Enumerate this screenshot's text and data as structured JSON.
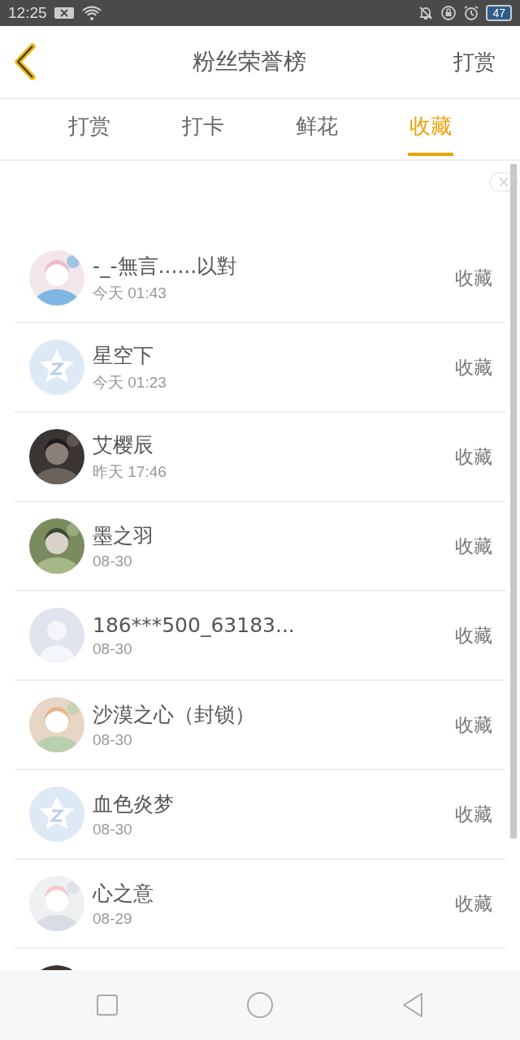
{
  "status_bar": {
    "time": "12:25",
    "battery": "47"
  },
  "header": {
    "title": "粉丝荣誉榜",
    "action": "打赏"
  },
  "tabs": [
    {
      "label": "打赏",
      "selected": false
    },
    {
      "label": "打卡",
      "selected": false
    },
    {
      "label": "鲜花",
      "selected": false
    },
    {
      "label": "收藏",
      "selected": true
    }
  ],
  "fans": [
    {
      "name": "-_-無言......以對",
      "time": "今天 01:43",
      "action": "收藏",
      "kind": "picture"
    },
    {
      "name": "星空下",
      "time": "今天 01:23",
      "action": "收藏",
      "kind": "star"
    },
    {
      "name": "艾樱辰",
      "time": "昨天 17:46",
      "action": "收藏",
      "kind": "picture"
    },
    {
      "name": "墨之羽",
      "time": "08-30",
      "action": "收藏",
      "kind": "picture"
    },
    {
      "name": "186***500_63183...",
      "time": "08-30",
      "action": "收藏",
      "kind": "person"
    },
    {
      "name": "沙漠之心（封锁）",
      "time": "08-30",
      "action": "收藏",
      "kind": "picture"
    },
    {
      "name": "血色炎梦",
      "time": "08-30",
      "action": "收藏",
      "kind": "star"
    },
    {
      "name": "心之意",
      "time": "08-29",
      "action": "收藏",
      "kind": "picture"
    },
    {
      "kind": "picture"
    }
  ]
}
